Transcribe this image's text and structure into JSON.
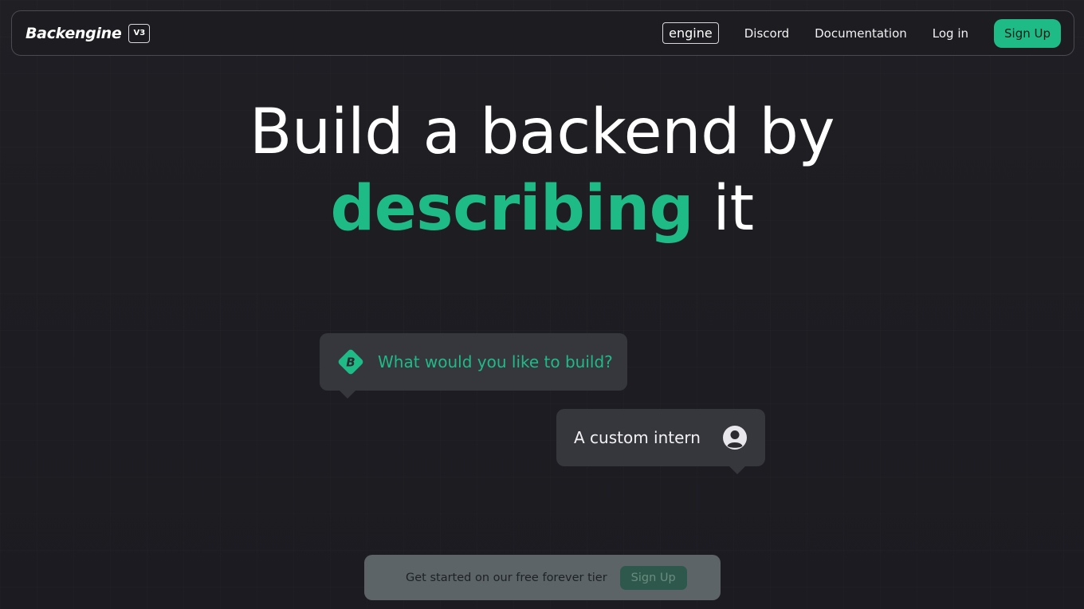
{
  "navbar": {
    "brand": "Backengine",
    "version": "V3",
    "links": {
      "engine": "engine",
      "discord": "Discord",
      "documentation": "Documentation",
      "login": "Log in"
    },
    "signup_label": "Sign Up"
  },
  "hero": {
    "line1": "Build a backend by",
    "accent": "describing",
    "line2_rest": " it"
  },
  "chat": {
    "question": "What would you like to build?",
    "answer": "A custom intern",
    "bot_icon": "backengine-logo-icon",
    "user_icon": "user-avatar-icon"
  },
  "cta": {
    "text": "Get started on our free forever tier",
    "signup_label": "Sign Up"
  },
  "colors": {
    "accent": "#1fbb87",
    "background": "#1d1d22",
    "bubble": "#36363d"
  }
}
